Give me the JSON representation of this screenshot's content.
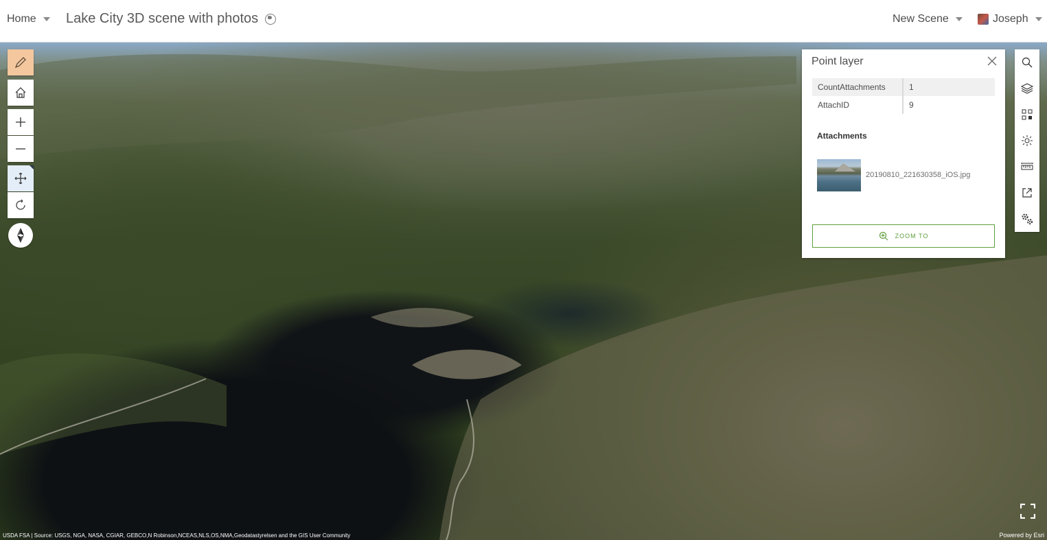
{
  "header": {
    "home_label": "Home",
    "scene_title": "Lake City 3D scene with photos",
    "new_scene_label": "New Scene",
    "user_name": "Joseph"
  },
  "map": {
    "attribution": "USDA FSA | Source: USGS, NGA, NASA, CGIAR, GEBCO,N Robinson,NCEAS,NLS,OS,NMA,Geodatastyrelsen and the GIS User Community",
    "powered_by": "Powered by Esri",
    "marker_color": "#37e8e6"
  },
  "left_tools": [
    {
      "name": "sketch-tool",
      "icon": "pencil-icon",
      "state": "active"
    },
    {
      "name": "home-tool",
      "icon": "home-icon"
    },
    {
      "name": "zoom-in-tool",
      "icon": "plus-icon"
    },
    {
      "name": "zoom-out-tool",
      "icon": "minus-icon"
    },
    {
      "name": "pan-tool",
      "icon": "move-icon",
      "state": "selected"
    },
    {
      "name": "rotate-tool",
      "icon": "rotate-icon"
    },
    {
      "name": "compass",
      "icon": "compass-icon"
    }
  ],
  "right_tools": [
    {
      "name": "search-tool",
      "icon": "search-icon"
    },
    {
      "name": "layers-tool",
      "icon": "layers-icon"
    },
    {
      "name": "basemap-tool",
      "icon": "basemap-grid-icon"
    },
    {
      "name": "daylight-tool",
      "icon": "sun-icon"
    },
    {
      "name": "measure-tool",
      "icon": "ruler-icon"
    },
    {
      "name": "share-tool",
      "icon": "share-icon"
    },
    {
      "name": "settings-tool",
      "icon": "gears-icon"
    }
  ],
  "popup": {
    "title": "Point layer",
    "fields": [
      {
        "key": "CountAttachments",
        "value": "1"
      },
      {
        "key": "AttachID",
        "value": "9"
      }
    ],
    "attachments_heading": "Attachments",
    "attachment_name": "20190810_221630358_iOS.jpg",
    "zoom_label": "ZOOM TO",
    "accent_color": "#5f9e3a"
  }
}
